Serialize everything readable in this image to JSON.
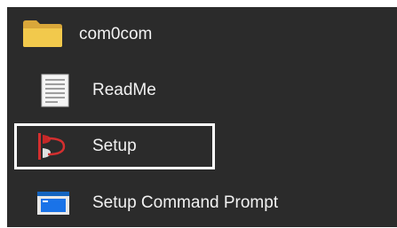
{
  "menu": {
    "folder": {
      "label": "com0com",
      "icon": "folder-icon",
      "color": "#f2c94c"
    },
    "items": [
      {
        "label": "ReadMe",
        "icon": "document-icon"
      },
      {
        "label": "Setup",
        "icon": "setup-icon",
        "focused": true
      },
      {
        "label": "Setup Command Prompt",
        "icon": "command-prompt-icon"
      }
    ]
  },
  "colors": {
    "background": "#2b2b2b",
    "text": "#f2f2f2",
    "focus_ring": "#ffffff",
    "accent": "#1a73e8"
  }
}
